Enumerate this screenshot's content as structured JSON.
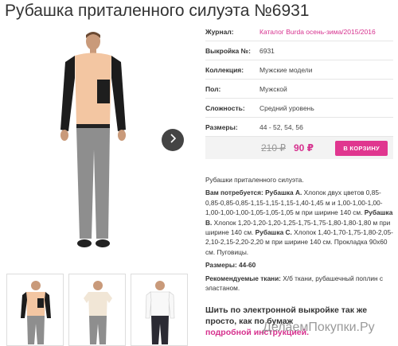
{
  "title": "Рубашка приталенного силуэта №6931",
  "properties": [
    {
      "label": "Журнал:",
      "value": "Каталог Burda осень-зима/2015/2016",
      "link": true
    },
    {
      "label": "Выкройка №:",
      "value": "6931",
      "link": false
    },
    {
      "label": "Коллекция:",
      "value": "Мужские модели",
      "link": false
    },
    {
      "label": "Пол:",
      "value": "Мужской",
      "link": false
    },
    {
      "label": "Сложность:",
      "value": "Средний уровень",
      "link": false
    },
    {
      "label": "Размеры:",
      "value": "44 - 52, 54, 56",
      "link": false
    }
  ],
  "price": {
    "old": "210 ₽",
    "new": "90 ₽",
    "cart_label": "В КОРЗИНУ"
  },
  "description": {
    "intro": "Рубашки приталенного силуэта.",
    "needed_label": "Вам потребуется:",
    "shirt_a_label": "Рубашка А.",
    "shirt_a_text": "Хлопок двух цветов 0,85-0,85-0,85-0,85-1,15-1,15-1,15-1,40-1,45 м и 1,00-1,00-1,00-1,00-1,00-1,00-1,05-1,05-1,05 м при ширине 140 см.",
    "shirt_b_label": "Рубашка В.",
    "shirt_b_text": "Хлопок 1,20-1,20-1,20-1,25-1,75-1,75-1,80-1,80-1,80 м при ширине 140 см.",
    "shirt_c_label": "Рубашка С.",
    "shirt_c_text": "Хлопок 1,40-1,70-1,75-1,80-2,05-2,10-2,15-2,20-2,20 м при ширине 140 см. Прокладка 90х60 см. Пуговицы.",
    "sizes_label": "Размеры:",
    "sizes_value": "44-60",
    "fabrics_label": "Рекомендуемые ткани:",
    "fabrics_text": "Х/б ткани, рубашечный поплин с эластаном."
  },
  "promo": {
    "text1": "Шить по электронной выкройке так же просто, как по бумаж",
    "link_text": "подробной инструкцией."
  },
  "watermark": "ДелаемПокупки.Ру",
  "colors": {
    "accent": "#d6318e",
    "button": "#e0368f"
  }
}
